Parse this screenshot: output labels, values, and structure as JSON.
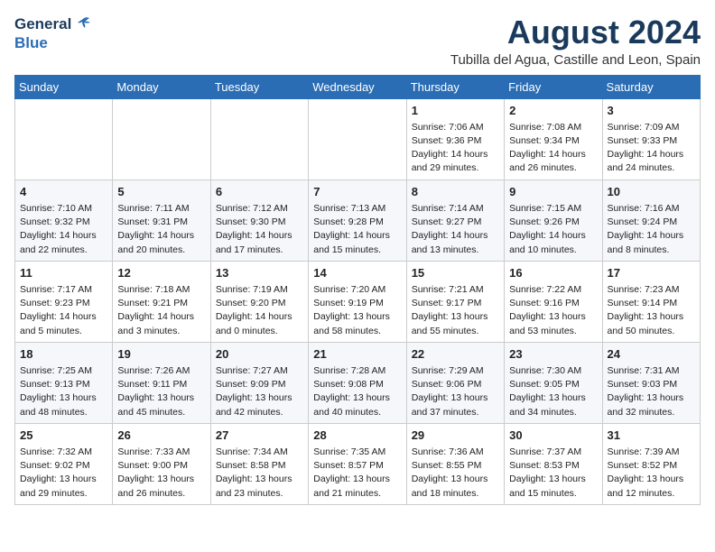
{
  "header": {
    "logo_general": "General",
    "logo_blue": "Blue",
    "month_year": "August 2024",
    "location": "Tubilla del Agua, Castille and Leon, Spain"
  },
  "days_of_week": [
    "Sunday",
    "Monday",
    "Tuesday",
    "Wednesday",
    "Thursday",
    "Friday",
    "Saturday"
  ],
  "weeks": [
    [
      {
        "day": "",
        "content": ""
      },
      {
        "day": "",
        "content": ""
      },
      {
        "day": "",
        "content": ""
      },
      {
        "day": "",
        "content": ""
      },
      {
        "day": "1",
        "content": "Sunrise: 7:06 AM\nSunset: 9:36 PM\nDaylight: 14 hours\nand 29 minutes."
      },
      {
        "day": "2",
        "content": "Sunrise: 7:08 AM\nSunset: 9:34 PM\nDaylight: 14 hours\nand 26 minutes."
      },
      {
        "day": "3",
        "content": "Sunrise: 7:09 AM\nSunset: 9:33 PM\nDaylight: 14 hours\nand 24 minutes."
      }
    ],
    [
      {
        "day": "4",
        "content": "Sunrise: 7:10 AM\nSunset: 9:32 PM\nDaylight: 14 hours\nand 22 minutes."
      },
      {
        "day": "5",
        "content": "Sunrise: 7:11 AM\nSunset: 9:31 PM\nDaylight: 14 hours\nand 20 minutes."
      },
      {
        "day": "6",
        "content": "Sunrise: 7:12 AM\nSunset: 9:30 PM\nDaylight: 14 hours\nand 17 minutes."
      },
      {
        "day": "7",
        "content": "Sunrise: 7:13 AM\nSunset: 9:28 PM\nDaylight: 14 hours\nand 15 minutes."
      },
      {
        "day": "8",
        "content": "Sunrise: 7:14 AM\nSunset: 9:27 PM\nDaylight: 14 hours\nand 13 minutes."
      },
      {
        "day": "9",
        "content": "Sunrise: 7:15 AM\nSunset: 9:26 PM\nDaylight: 14 hours\nand 10 minutes."
      },
      {
        "day": "10",
        "content": "Sunrise: 7:16 AM\nSunset: 9:24 PM\nDaylight: 14 hours\nand 8 minutes."
      }
    ],
    [
      {
        "day": "11",
        "content": "Sunrise: 7:17 AM\nSunset: 9:23 PM\nDaylight: 14 hours\nand 5 minutes."
      },
      {
        "day": "12",
        "content": "Sunrise: 7:18 AM\nSunset: 9:21 PM\nDaylight: 14 hours\nand 3 minutes."
      },
      {
        "day": "13",
        "content": "Sunrise: 7:19 AM\nSunset: 9:20 PM\nDaylight: 14 hours\nand 0 minutes."
      },
      {
        "day": "14",
        "content": "Sunrise: 7:20 AM\nSunset: 9:19 PM\nDaylight: 13 hours\nand 58 minutes."
      },
      {
        "day": "15",
        "content": "Sunrise: 7:21 AM\nSunset: 9:17 PM\nDaylight: 13 hours\nand 55 minutes."
      },
      {
        "day": "16",
        "content": "Sunrise: 7:22 AM\nSunset: 9:16 PM\nDaylight: 13 hours\nand 53 minutes."
      },
      {
        "day": "17",
        "content": "Sunrise: 7:23 AM\nSunset: 9:14 PM\nDaylight: 13 hours\nand 50 minutes."
      }
    ],
    [
      {
        "day": "18",
        "content": "Sunrise: 7:25 AM\nSunset: 9:13 PM\nDaylight: 13 hours\nand 48 minutes."
      },
      {
        "day": "19",
        "content": "Sunrise: 7:26 AM\nSunset: 9:11 PM\nDaylight: 13 hours\nand 45 minutes."
      },
      {
        "day": "20",
        "content": "Sunrise: 7:27 AM\nSunset: 9:09 PM\nDaylight: 13 hours\nand 42 minutes."
      },
      {
        "day": "21",
        "content": "Sunrise: 7:28 AM\nSunset: 9:08 PM\nDaylight: 13 hours\nand 40 minutes."
      },
      {
        "day": "22",
        "content": "Sunrise: 7:29 AM\nSunset: 9:06 PM\nDaylight: 13 hours\nand 37 minutes."
      },
      {
        "day": "23",
        "content": "Sunrise: 7:30 AM\nSunset: 9:05 PM\nDaylight: 13 hours\nand 34 minutes."
      },
      {
        "day": "24",
        "content": "Sunrise: 7:31 AM\nSunset: 9:03 PM\nDaylight: 13 hours\nand 32 minutes."
      }
    ],
    [
      {
        "day": "25",
        "content": "Sunrise: 7:32 AM\nSunset: 9:02 PM\nDaylight: 13 hours\nand 29 minutes."
      },
      {
        "day": "26",
        "content": "Sunrise: 7:33 AM\nSunset: 9:00 PM\nDaylight: 13 hours\nand 26 minutes."
      },
      {
        "day": "27",
        "content": "Sunrise: 7:34 AM\nSunset: 8:58 PM\nDaylight: 13 hours\nand 23 minutes."
      },
      {
        "day": "28",
        "content": "Sunrise: 7:35 AM\nSunset: 8:57 PM\nDaylight: 13 hours\nand 21 minutes."
      },
      {
        "day": "29",
        "content": "Sunrise: 7:36 AM\nSunset: 8:55 PM\nDaylight: 13 hours\nand 18 minutes."
      },
      {
        "day": "30",
        "content": "Sunrise: 7:37 AM\nSunset: 8:53 PM\nDaylight: 13 hours\nand 15 minutes."
      },
      {
        "day": "31",
        "content": "Sunrise: 7:39 AM\nSunset: 8:52 PM\nDaylight: 13 hours\nand 12 minutes."
      }
    ]
  ]
}
